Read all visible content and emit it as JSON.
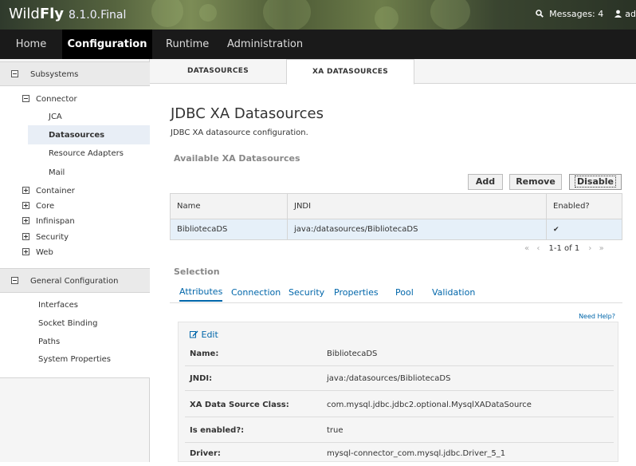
{
  "header": {
    "brand_light": "Wild",
    "brand_bold": "Fly",
    "version": "8.1.0.Final",
    "messages": "Messages: 4",
    "user": "ad"
  },
  "nav": {
    "items": [
      "Home",
      "Configuration",
      "Runtime",
      "Administration"
    ],
    "active": "Configuration"
  },
  "sidebar": {
    "subsystems_label": "Subsystems",
    "connector_label": "Connector",
    "connector_items": [
      "JCA",
      "Datasources",
      "Resource Adapters",
      "Mail"
    ],
    "selected": "Datasources",
    "groups": [
      "Container",
      "Core",
      "Infinispan",
      "Security",
      "Web"
    ],
    "general_label": "General Configuration",
    "general_items": [
      "Interfaces",
      "Socket Binding",
      "Paths",
      "System Properties"
    ]
  },
  "tabs": {
    "items": [
      "DATASOURCES",
      "XA DATASOURCES"
    ],
    "active": "XA DATASOURCES"
  },
  "main": {
    "title": "JDBC XA Datasources",
    "description": "JDBC XA datasource configuration.",
    "available_label": "Available XA Datasources",
    "buttons": {
      "add": "Add",
      "remove": "Remove",
      "disable": "Disable"
    },
    "table": {
      "columns": [
        "Name",
        "JNDI",
        "Enabled?"
      ],
      "rows": [
        {
          "name": "BibliotecaDS",
          "jndi": "java:/datasources/BibliotecaDS",
          "enabled": "✔"
        }
      ]
    },
    "pager": {
      "first": "«",
      "prev": "‹",
      "range": "1-1 of 1",
      "next": "›",
      "last": "»"
    },
    "selection_label": "Selection",
    "subtabs": [
      "Attributes",
      "Connection",
      "Security",
      "Properties",
      "Pool",
      "Validation"
    ],
    "active_subtab": "Attributes",
    "need_help": "Need Help?",
    "edit_label": "Edit",
    "attributes": [
      {
        "key": "Name:",
        "value": "BibliotecaDS"
      },
      {
        "key": "JNDI:",
        "value": "java:/datasources/BibliotecaDS"
      },
      {
        "key": "XA Data Source Class:",
        "value": "com.mysql.jdbc.jdbc2.optional.MysqlXADataSource"
      },
      {
        "key": "Is enabled?:",
        "value": "true"
      },
      {
        "key": "Driver:",
        "value": "mysql-connector_com.mysql.jdbc.Driver_5_1"
      }
    ]
  },
  "colors": {
    "accent": "#0066aa",
    "navbar": "#1a1a1a",
    "selected_row": "#e6f0f9"
  },
  "icons": {
    "search": "search-icon",
    "user": "user-icon",
    "edit": "edit-icon",
    "check": "check-icon"
  }
}
